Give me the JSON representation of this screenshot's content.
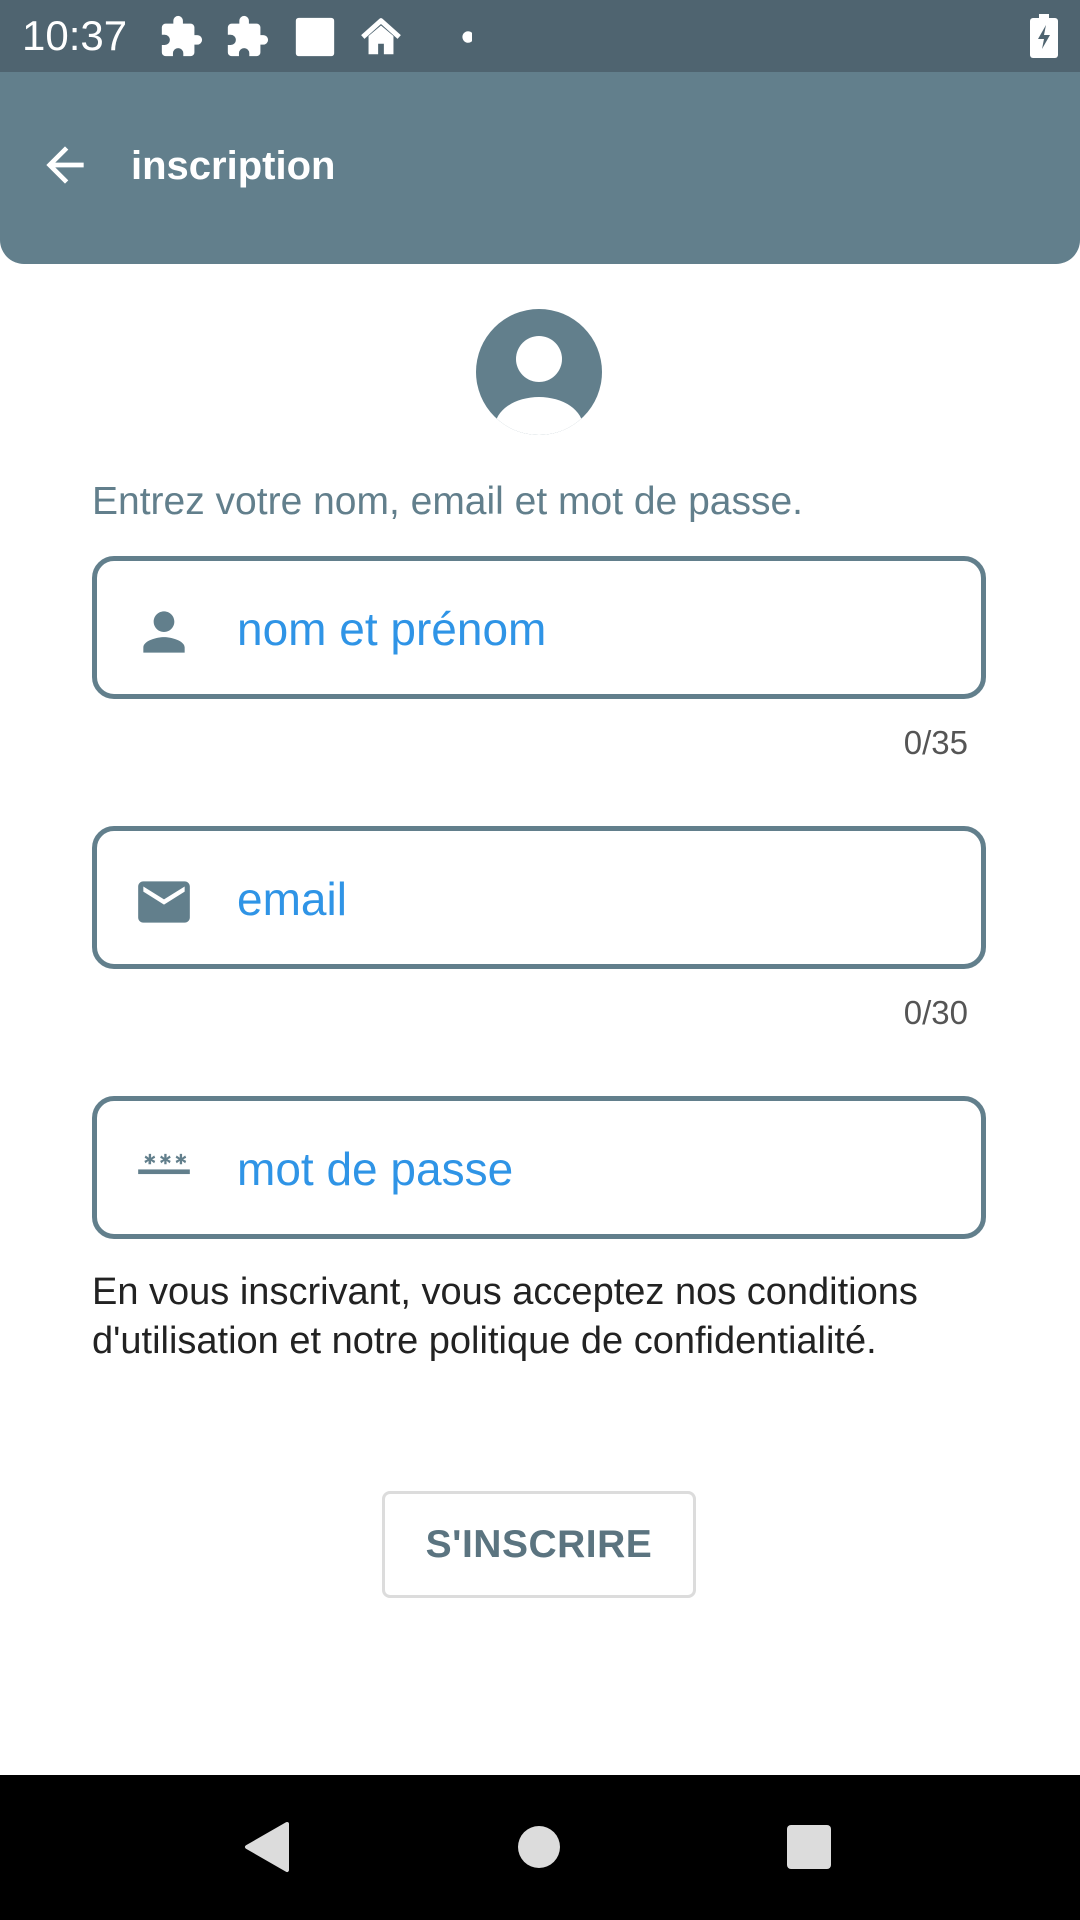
{
  "status_bar": {
    "time": "10:37",
    "icons": [
      "puzzle-icon",
      "puzzle-icon",
      "square-icon",
      "home-icon",
      "dot-icon",
      "battery-charging-icon"
    ]
  },
  "app_bar": {
    "title": "inscription",
    "back_icon": "arrow-left-icon"
  },
  "form": {
    "instructions": "Entrez votre nom, email et mot de passe.",
    "name_field": {
      "placeholder": "nom et prénom",
      "value": "",
      "counter": "0/35",
      "icon": "person-icon"
    },
    "email_field": {
      "placeholder": "email",
      "value": "",
      "counter": "0/30",
      "icon": "mail-icon"
    },
    "password_field": {
      "placeholder": "mot de passe",
      "value": "",
      "icon": "password-icon"
    },
    "terms": "En vous inscrivant, vous acceptez nos conditions d'utilisation et notre politique de confidentialité.",
    "submit_label": "S'INSCRIRE"
  },
  "nav_bar": {
    "icons": [
      "back-triangle-icon",
      "home-circle-icon",
      "recents-square-icon"
    ]
  },
  "colors": {
    "status_bar": "#4f6470",
    "app_bar": "#627f8c",
    "accent": "#627f8c",
    "placeholder": "#2f94e6",
    "nav_bar": "#000000"
  }
}
